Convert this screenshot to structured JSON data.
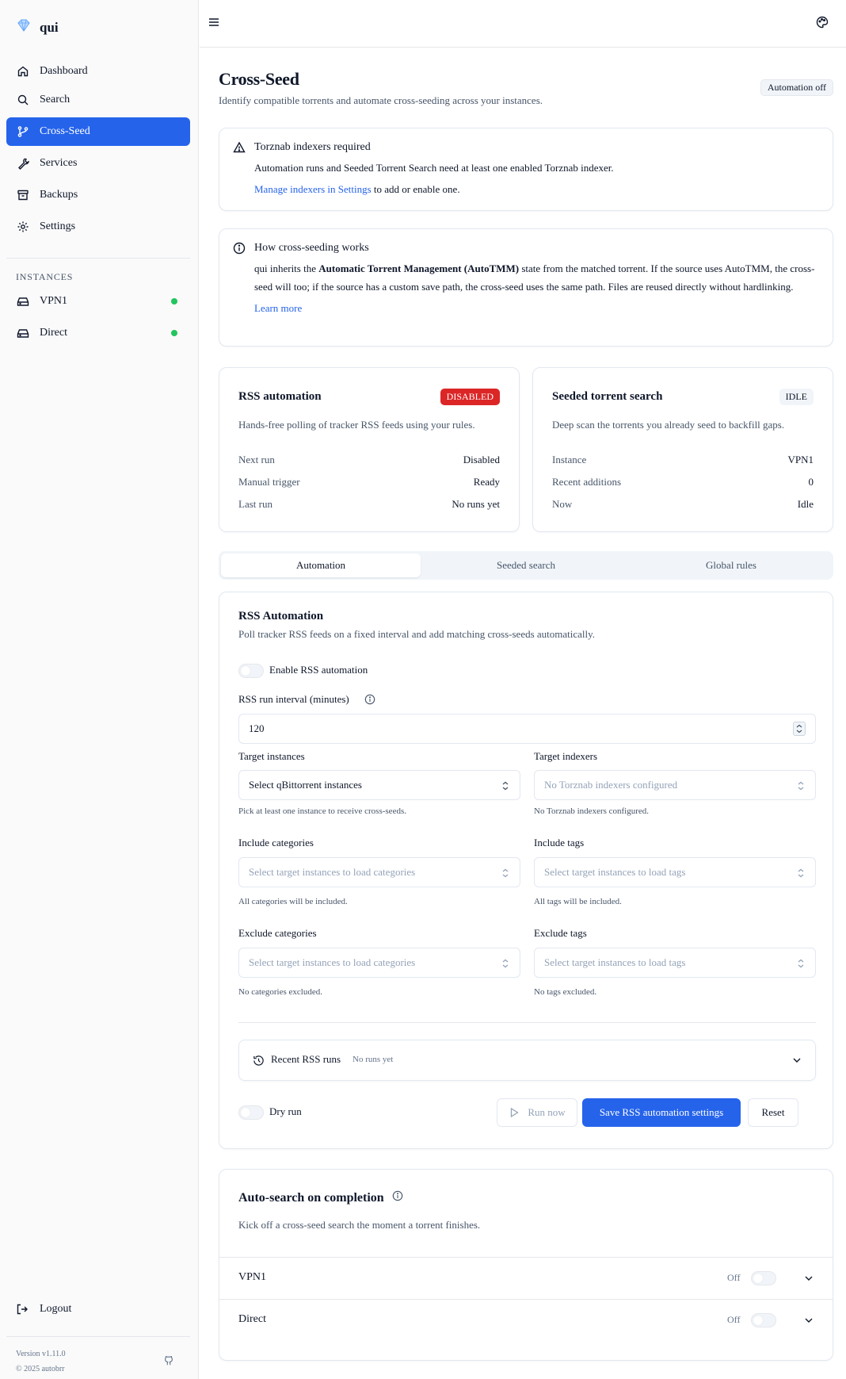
{
  "sidebar": {
    "app_name": "qui",
    "nav": [
      {
        "label": "Dashboard"
      },
      {
        "label": "Search"
      },
      {
        "label": "Cross-Seed"
      },
      {
        "label": "Services"
      },
      {
        "label": "Backups"
      },
      {
        "label": "Settings"
      }
    ],
    "instances_label": "INSTANCES",
    "instances": [
      {
        "label": "VPN1"
      },
      {
        "label": "Direct"
      }
    ],
    "logout_label": "Logout",
    "version": "Version v1.11.0",
    "copyright": "© 2025 autobrr"
  },
  "header": {
    "title": "Cross-Seed",
    "subtitle": "Identify compatible torrents and automate cross-seeding across your instances.",
    "automation_badge": "Automation off"
  },
  "alerts": {
    "torznab": {
      "title": "Torznab indexers required",
      "text": "Automation runs and Seeded Torrent Search need at least one enabled Torznab indexer.",
      "link": "Manage indexers in Settings",
      "link_suffix": " to add or enable one."
    },
    "howto": {
      "title": "How cross-seeding works",
      "text_pre": "qui inherits the ",
      "text_bold": "Automatic Torrent Management (AutoTMM)",
      "text_post": " state from the matched torrent. If the source uses AutoTMM, the cross-seed will too; if the source has a custom save path, the cross-seed uses the same path. Files are reused directly without hardlinking.",
      "link": "Learn more"
    }
  },
  "rss_card": {
    "title": "RSS automation",
    "badge": "DISABLED",
    "desc": "Hands-free polling of tracker RSS feeds using your rules.",
    "rows": [
      {
        "k": "Next run",
        "v": "Disabled"
      },
      {
        "k": "Manual trigger",
        "v": "Ready"
      },
      {
        "k": "Last run",
        "v": "No runs yet"
      }
    ]
  },
  "seeded_card": {
    "title": "Seeded torrent search",
    "badge": "IDLE",
    "desc": "Deep scan the torrents you already seed to backfill gaps.",
    "rows": [
      {
        "k": "Instance",
        "v": "VPN1"
      },
      {
        "k": "Recent additions",
        "v": "0"
      },
      {
        "k": "Now",
        "v": "Idle"
      }
    ]
  },
  "tabs": [
    {
      "label": "Automation"
    },
    {
      "label": "Seeded search"
    },
    {
      "label": "Global rules"
    }
  ],
  "rss_form": {
    "title": "RSS Automation",
    "subtitle": "Poll tracker RSS feeds on a fixed interval and add matching cross-seeds automatically.",
    "enable_label": "Enable RSS automation",
    "interval_label": "RSS run interval (minutes)",
    "interval_value": "120",
    "target_instances_label": "Target instances",
    "target_instances_placeholder": "Select qBittorrent instances",
    "target_instances_help": "Pick at least one instance to receive cross-seeds.",
    "target_indexers_label": "Target indexers",
    "target_indexers_placeholder": "No Torznab indexers configured",
    "target_indexers_help": "No Torznab indexers configured.",
    "include_categories_label": "Include categories",
    "include_categories_placeholder": "Select target instances to load categories",
    "include_categories_help": "All categories will be included.",
    "include_tags_label": "Include tags",
    "include_tags_placeholder": "Select target instances to load tags",
    "include_tags_help": "All tags will be included.",
    "exclude_categories_label": "Exclude categories",
    "exclude_categories_placeholder": "Select target instances to load categories",
    "exclude_categories_help": "No categories excluded.",
    "exclude_tags_label": "Exclude tags",
    "exclude_tags_placeholder": "Select target instances to load tags",
    "exclude_tags_help": "No tags excluded.",
    "recent_runs_label": "Recent RSS runs",
    "recent_runs_status": "No runs yet",
    "dry_run_label": "Dry run",
    "run_now_label": "Run now",
    "save_label": "Save RSS automation settings",
    "reset_label": "Reset"
  },
  "auto_search": {
    "title": "Auto-search on completion",
    "subtitle": "Kick off a cross-seed search the moment a torrent finishes.",
    "rows": [
      {
        "name": "VPN1",
        "state": "Off"
      },
      {
        "name": "Direct",
        "state": "Off"
      }
    ]
  },
  "colors": {
    "accent": "#2563eb",
    "danger": "#dc2626",
    "online": "#22c55e"
  }
}
